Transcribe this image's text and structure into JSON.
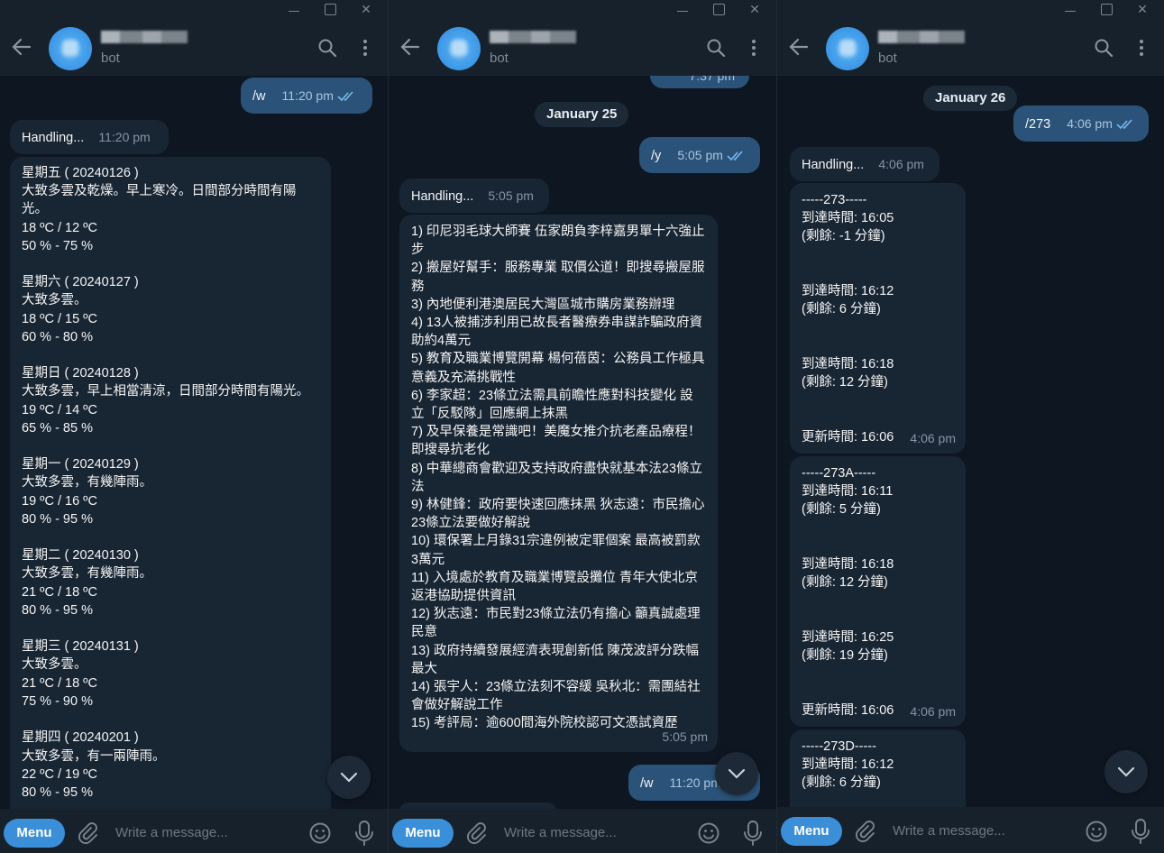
{
  "colors": {
    "accent": "#3a8fd8",
    "bg": "#0e1621",
    "bubble_in": "#182533",
    "bubble_out": "#2b5278"
  },
  "chat": {
    "subtitle": "bot"
  },
  "composer": {
    "menu_label": "Menu",
    "placeholder": "Write a message..."
  },
  "panel1": {
    "out_cmd": "/w",
    "out_time": "11:20 pm",
    "handling": "Handling...",
    "handling_time": "11:20 pm",
    "forecast": "星期五 ( 20240126 )\n大致多雲及乾燥。早上寒冷。日間部分時間有陽光。\n18 ºC / 12 ºC\n50 % - 75 %\n\n星期六 ( 20240127 )\n大致多雲。\n18 ºC / 15 ºC\n60 % - 80 %\n\n星期日 ( 20240128 )\n大致多雲，早上相當清涼，日間部分時間有陽光。\n19 ºC / 14 ºC\n65 % - 85 %\n\n星期一 ( 20240129 )\n大致多雲，有幾陣雨。\n19 ºC / 16 ºC\n80 % - 95 %\n\n星期二 ( 20240130 )\n大致多雲，有幾陣雨。\n21 ºC / 18 ºC\n80 % - 95 %\n\n星期三 ( 20240131 )\n大致多雲。\n21 ºC / 18 ºC\n75 % - 90 %\n\n星期四 ( 20240201 )\n大致多雲，有一兩陣雨。\n22 ºC / 19 ºC\n80 % - 95 %"
  },
  "panel2": {
    "prev_time": "7:37 pm",
    "date": "January 25",
    "out_cmd": "/y",
    "out_time": "5:05 pm",
    "handling": "Handling...",
    "handling_time": "5:05 pm",
    "news": "1) 印尼羽毛球大師賽 伍家朗負李梓嘉男單十六強止步\n2) 搬屋好幫手：服務專業 取價公道！即搜尋搬屋服務\n3) 內地便利港澳居民大灣區城市購房業務辦理\n4) 13人被捕涉利用已故長者醫療券串謀詐騙政府資助約4萬元\n5) 教育及職業博覽開幕 楊何蓓茵：公務員工作極具意義及充滿挑戰性\n6) 李家超：23條立法需具前瞻性應對科技變化 設立「反駁隊」回應網上抹黑\n7) 及早保養是常識吧！美魔女推介抗老產品療程！即搜尋抗老化\n8) 中華總商會歡迎及支持政府盡快就基本法23條立法\n9) 林健鋒：政府要快速回應抹黑 狄志遠：市民擔心23條立法要做好解說\n10) 環保署上月錄31宗違例被定罪個案 最高被罰款3萬元\n11) 入境處於教育及職業博覽設攤位 青年大使北京返港協助提供資訊\n12) 狄志遠：市民對23條立法仍有擔心 籲真誠處理民意\n13) 政府持續發展經濟表現創新低 陳茂波評分跌幅最大\n14) 張宇人：23條立法刻不容緩 吳秋北：需團結社會做好解說工作\n15) 考評局：逾600間海外院校認可文憑試資歷",
    "news_time": "5:05 pm",
    "out2_cmd": "/w",
    "out2_time": "11:20 pm"
  },
  "panel3": {
    "date": "January 26",
    "out_cmd": "/273",
    "out_time": "4:06 pm",
    "handling": "Handling...",
    "handling_time": "4:06 pm",
    "route1": "-----273-----\n到達時間: 16:05\n(剩餘: -1 分鐘)\n\n\n到達時間: 16:12\n(剩餘: 6 分鐘)\n\n\n到達時間: 16:18\n(剩餘: 12 分鐘)\n\n\n更新時間: 16:06",
    "route1_time": "4:06 pm",
    "route2": "-----273A-----\n到達時間: 16:11\n(剩餘: 5 分鐘)\n\n\n到達時間: 16:18\n(剩餘: 12 分鐘)\n\n\n到達時間: 16:25\n(剩餘: 19 分鐘)\n\n\n更新時間: 16:06",
    "route2_time": "4:06 pm",
    "route3": "-----273D-----\n到達時間: 16:12\n(剩餘: 6 分鐘)"
  }
}
